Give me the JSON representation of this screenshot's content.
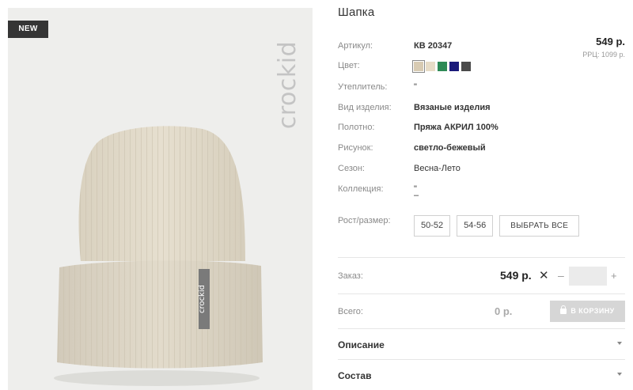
{
  "product": {
    "badge": "NEW",
    "watermark": "crockid",
    "hat_label": "crockid",
    "title": "Шапка",
    "price": "549 р.",
    "rrp": "РРЦ: 1099 р."
  },
  "specs": [
    {
      "label": "Артикул:",
      "value": "КВ 20347"
    },
    {
      "label": "Цвет:",
      "value": ""
    },
    {
      "label": "Утеплитель:",
      "value": "\""
    },
    {
      "label": "Вид изделия:",
      "value": "Вязаные изделия"
    },
    {
      "label": "Полотно:",
      "value": "Пряжа АКРИЛ 100%"
    },
    {
      "label": "Рисунок:",
      "value": "светло-бежевый"
    },
    {
      "label": "Сезон:",
      "value": "Весна-Лето"
    },
    {
      "label": "Коллекция:",
      "value": "\""
    },
    {
      "label": "Рост/размер:",
      "value": ""
    }
  ],
  "collection_extra": "–",
  "colors": [
    "#d8cbb3",
    "#e7dcc7",
    "#2e8a56",
    "#1a1a7a",
    "#4a4a4a"
  ],
  "sizes": {
    "options": [
      "50-52",
      "54-56"
    ],
    "select_all": "ВЫБРАТЬ ВСЕ"
  },
  "order": {
    "label": "Заказ:",
    "price": "549 р.",
    "times": "✕",
    "minus": "–",
    "qty": "",
    "plus": "+"
  },
  "total": {
    "label": "Всего:",
    "value": "0 р.",
    "cart_button": "В КОРЗИНУ"
  },
  "accordion": [
    {
      "label": "Описание"
    },
    {
      "label": "Состав"
    }
  ],
  "icons": {
    "arrow": "chevron-down-icon",
    "lock": "lock-icon"
  }
}
